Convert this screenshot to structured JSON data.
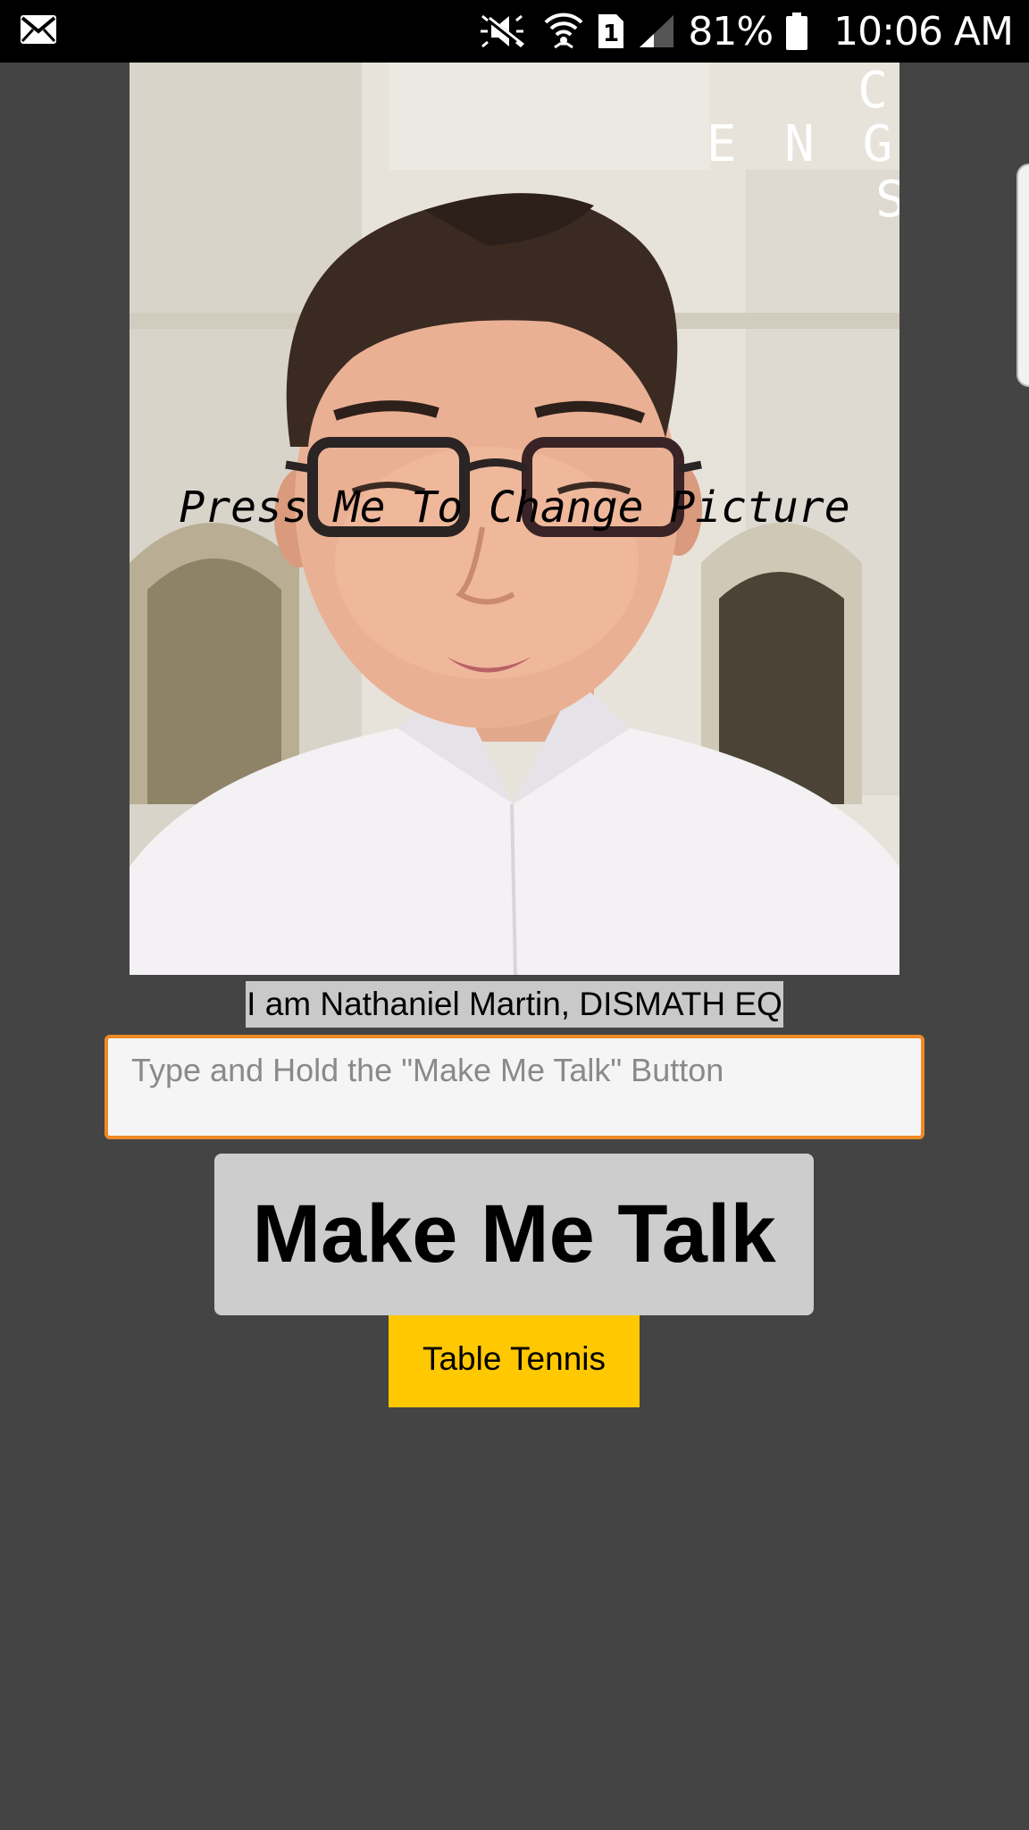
{
  "status_bar": {
    "icons": [
      "mail-icon",
      "mute-icon",
      "wifi-icon",
      "sim-1-icon",
      "signal-icon",
      "battery-icon"
    ],
    "battery": "81%",
    "time": "10:06 AM"
  },
  "photo": {
    "overlay_text": "Press Me To Change Picture",
    "watermark_letters": [
      "C",
      "E N G",
      "S"
    ]
  },
  "profile": {
    "name_label": "I am Nathaniel Martin, DISMATH EQ"
  },
  "speech_input": {
    "value": "",
    "placeholder": "Type and Hold the \"Make Me Talk\" Button"
  },
  "buttons": {
    "talk_label": "Make Me Talk",
    "hobby_label": "Table Tennis"
  },
  "colors": {
    "background": "#444444",
    "input_border": "#f08a24",
    "talk_button": "#cdcdcd",
    "hobby_button": "#ffc800"
  }
}
